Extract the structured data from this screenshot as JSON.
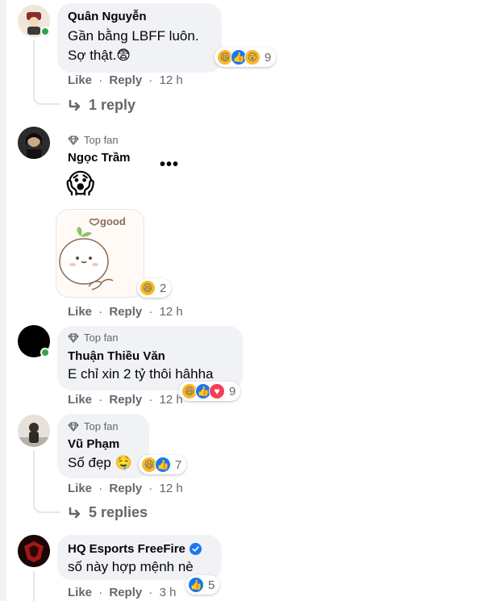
{
  "comments": [
    {
      "author": "Quân Nguyễn",
      "text_line1": "Gần bằng LBFF luôn.",
      "text_line2": "Sợ thật.😨",
      "reaction_count": "9",
      "like": "Like",
      "reply": "Reply",
      "time": "12 h",
      "replies_link": "1 reply"
    },
    {
      "badge": "Top fan",
      "author": "Ngọc Trầm",
      "emoji": "😱",
      "sticker_text": "good",
      "reaction_count": "2",
      "like": "Like",
      "reply": "Reply",
      "time": "12 h"
    },
    {
      "badge": "Top fan",
      "author": "Thuận Thiều Văn",
      "text": "E chỉ xin 2 tỷ thôi hâhha",
      "reaction_count": "9",
      "like": "Like",
      "reply": "Reply",
      "time": "12 h"
    },
    {
      "badge": "Top fan",
      "author": "Vũ Phạm",
      "text": "Số đẹp 🤤",
      "reaction_count": "7",
      "like": "Like",
      "reply": "Reply",
      "time": "12 h",
      "replies_link": "5 replies"
    },
    {
      "author": "HQ Esports FreeFire",
      "text": "số này hợp mệnh nè",
      "reaction_count": "5",
      "like": "Like",
      "reply": "Reply",
      "time": "3 h"
    }
  ],
  "separator": "·",
  "colors": {
    "bubble": "#f0f2f5",
    "meta": "#65676b",
    "online": "#31a24c",
    "like": "#1877f2",
    "haha": "#f7b928",
    "love": "#f33e58"
  },
  "icons": [
    "haha-icon",
    "like-icon",
    "wow-icon",
    "love-icon",
    "reply-arrow-icon",
    "diamond-icon",
    "verified-icon",
    "more-dots-icon"
  ]
}
